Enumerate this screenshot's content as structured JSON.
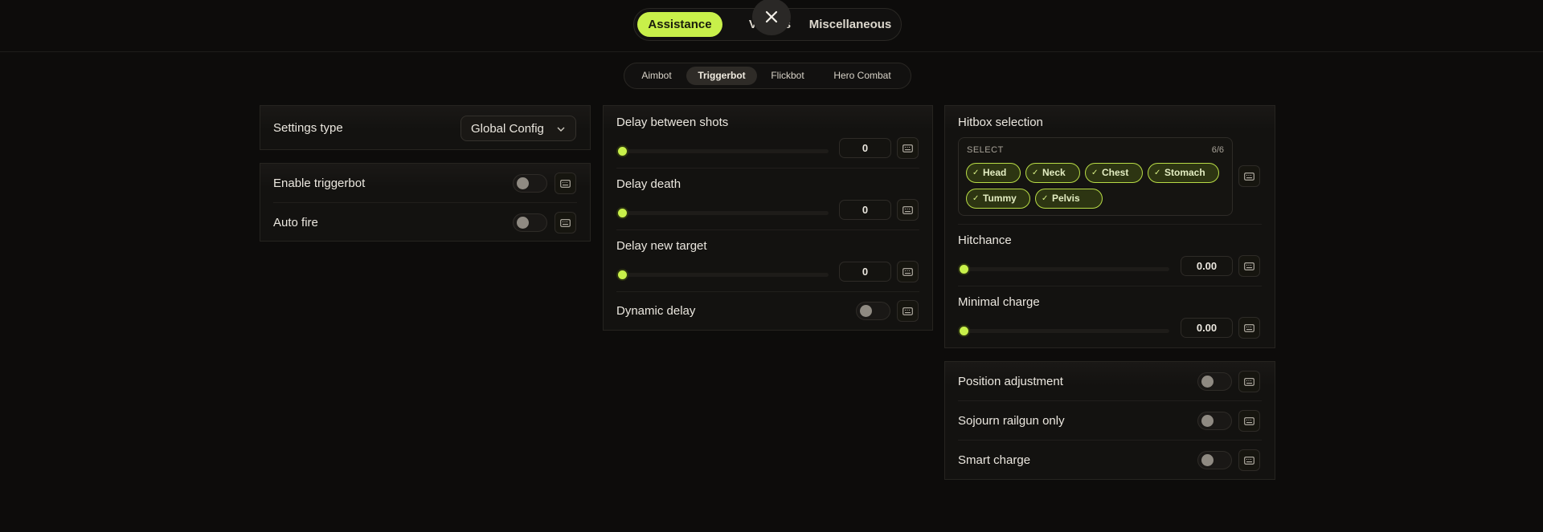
{
  "main_tabs": [
    {
      "label": "Assistance",
      "active": true
    },
    {
      "label": "Visuals",
      "active": false
    },
    {
      "label": "Miscellaneous",
      "active": false
    }
  ],
  "sub_tabs": [
    {
      "label": "Aimbot",
      "active": false
    },
    {
      "label": "Triggerbot",
      "active": true
    },
    {
      "label": "Flickbot",
      "active": false
    },
    {
      "label": "Hero Combat",
      "active": false
    }
  ],
  "settings": {
    "label": "Settings type",
    "value": "Global Config"
  },
  "left_toggles": [
    {
      "label": "Enable triggerbot",
      "on": false
    },
    {
      "label": "Auto fire",
      "on": false
    }
  ],
  "delays": [
    {
      "label": "Delay between shots",
      "value": "0",
      "fraction": 0
    },
    {
      "label": "Delay death",
      "value": "0",
      "fraction": 0
    },
    {
      "label": "Delay new target",
      "value": "0",
      "fraction": 0
    }
  ],
  "dynamic_delay": {
    "label": "Dynamic delay",
    "on": false
  },
  "hitbox": {
    "title": "Hitbox selection",
    "select_label": "SELECT",
    "count": "6/6",
    "chips": [
      "Head",
      "Neck",
      "Chest",
      "Stomach",
      "Tummy",
      "Pelvis"
    ]
  },
  "sliders_right": [
    {
      "label": "Hitchance",
      "value": "0.00",
      "fraction": 0
    },
    {
      "label": "Minimal charge",
      "value": "0.00",
      "fraction": 0
    }
  ],
  "right_toggles": [
    {
      "label": "Position adjustment",
      "on": false
    },
    {
      "label": "Sojourn railgun only",
      "on": false
    },
    {
      "label": "Smart charge",
      "on": false
    }
  ],
  "colors": {
    "accent": "#c8f04a",
    "background": "#0d0c0b",
    "panel": "#131210"
  },
  "icons": {
    "close": "close-icon",
    "keybind": "keyboard-icon",
    "chevron": "chevron-down-icon",
    "check": "check-icon"
  }
}
